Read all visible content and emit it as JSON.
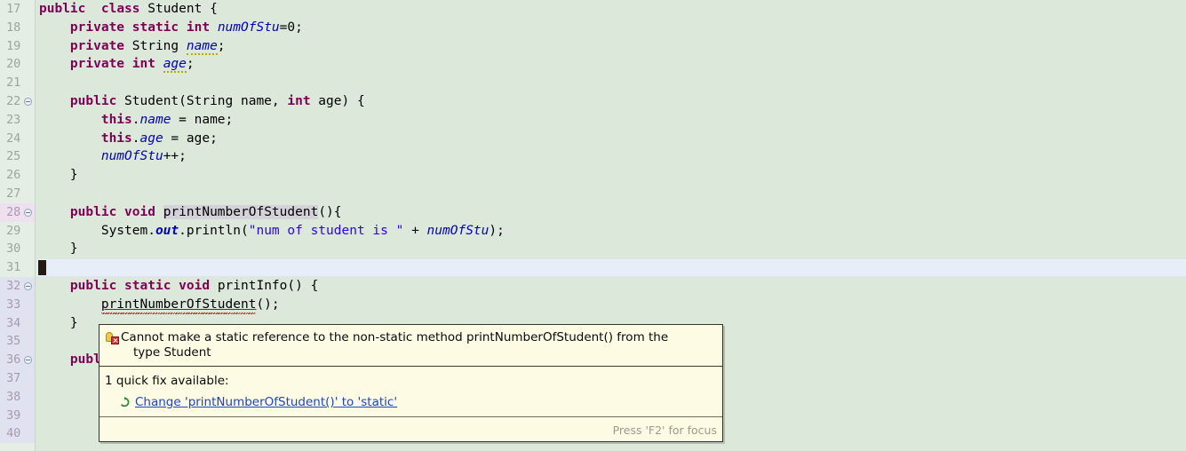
{
  "editor": {
    "first_line": 17,
    "last_line": 40,
    "current_line": 31,
    "lines": [
      {
        "n": 17,
        "gutter_tint": "",
        "fold": false,
        "text": "public  class Student {"
      },
      {
        "n": 18,
        "gutter_tint": "",
        "fold": false,
        "text": "    private static int numOfStu=0;"
      },
      {
        "n": 19,
        "gutter_tint": "",
        "fold": false,
        "text": "    private String name;"
      },
      {
        "n": 20,
        "gutter_tint": "",
        "fold": false,
        "text": "    private int age;"
      },
      {
        "n": 21,
        "gutter_tint": "",
        "fold": false,
        "text": ""
      },
      {
        "n": 22,
        "gutter_tint": "",
        "fold": true,
        "text": "    public Student(String name, int age) {"
      },
      {
        "n": 23,
        "gutter_tint": "",
        "fold": false,
        "text": "        this.name = name;"
      },
      {
        "n": 24,
        "gutter_tint": "",
        "fold": false,
        "text": "        this.age = age;"
      },
      {
        "n": 25,
        "gutter_tint": "",
        "fold": false,
        "text": "        numOfStu++;"
      },
      {
        "n": 26,
        "gutter_tint": "",
        "fold": false,
        "text": "    }"
      },
      {
        "n": 27,
        "gutter_tint": "",
        "fold": false,
        "text": ""
      },
      {
        "n": 28,
        "gutter_tint": "tint-b",
        "fold": true,
        "text": "    public void printNumberOfStudent(){"
      },
      {
        "n": 29,
        "gutter_tint": "",
        "fold": false,
        "text": "        System.out.println(\"num of student is \" + numOfStu);"
      },
      {
        "n": 30,
        "gutter_tint": "",
        "fold": false,
        "text": "    }"
      },
      {
        "n": 31,
        "gutter_tint": "",
        "fold": false,
        "text": ""
      },
      {
        "n": 32,
        "gutter_tint": "tint-a",
        "fold": true,
        "text": "    public static void printInfo() {"
      },
      {
        "n": 33,
        "gutter_tint": "tint-a",
        "fold": false,
        "text": "        printNumberOfStudent();"
      },
      {
        "n": 34,
        "gutter_tint": "tint-a",
        "fold": false,
        "text": "    }"
      },
      {
        "n": 35,
        "gutter_tint": "tint-a",
        "fold": false,
        "text": ""
      },
      {
        "n": 36,
        "gutter_tint": "tint-a",
        "fold": true,
        "text": "    publ"
      },
      {
        "n": 37,
        "gutter_tint": "tint-a",
        "fold": false,
        "text": ""
      },
      {
        "n": 38,
        "gutter_tint": "tint-a",
        "fold": false,
        "text": ""
      },
      {
        "n": 39,
        "gutter_tint": "tint-a",
        "fold": false,
        "text": ""
      },
      {
        "n": 40,
        "gutter_tint": "tint-a",
        "fold": false,
        "text": ""
      }
    ],
    "colors": {
      "background": "#dce8da",
      "gutter_background": "#e5eee4",
      "current_line": "#e7eef8",
      "keyword": "#7f0055",
      "field": "#0000c0",
      "string": "#2a00ff",
      "occurrence_highlight": "#d4d1db",
      "error_underline": "#d40000",
      "warning_underline": "#c8a000"
    }
  },
  "tooltip": {
    "message_line1": "Cannot make a static reference to the non-static method printNumberOfStudent() from the",
    "message_line2": "type Student",
    "quick_fix_header": "1 quick fix available:",
    "quick_fix_label": "Change 'printNumberOfStudent()' to 'static'",
    "footer": "Press 'F2' for focus",
    "background": "#fdfbe3",
    "border": "#34342c",
    "link_color": "#1a44cc",
    "footer_color": "#9b9b88"
  }
}
